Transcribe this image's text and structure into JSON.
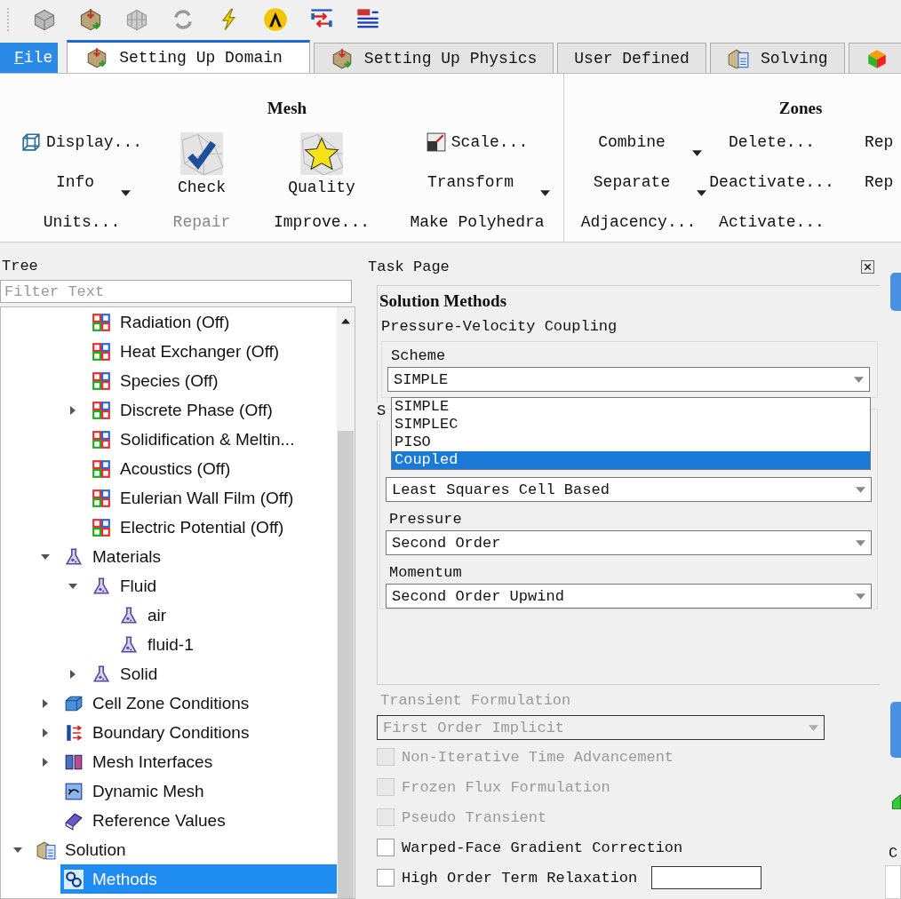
{
  "menu": {
    "label": "File"
  },
  "tabs": [
    {
      "label": "Setting Up Domain",
      "selected": true
    },
    {
      "label": "Setting Up Physics",
      "selected": false
    },
    {
      "label": "User Defined",
      "selected": false
    },
    {
      "label": "Solving",
      "selected": false
    },
    {
      "selected": false
    }
  ],
  "ribbon": {
    "groups": [
      {
        "title": "Mesh",
        "columns": [
          [
            {
              "label": "Display...",
              "kind": "icon",
              "disabled": false
            },
            {
              "label": "Info",
              "kind": "dropdown",
              "disabled": false
            },
            {
              "label": "Units...",
              "kind": "plain",
              "disabled": false
            }
          ],
          [
            {
              "label": "Check",
              "kind": "big",
              "disabled": false
            },
            {
              "label": "Repair",
              "kind": "plain",
              "disabled": true
            }
          ],
          [
            {
              "label": "Quality",
              "kind": "big",
              "disabled": false
            },
            {
              "label": "Improve...",
              "kind": "plain",
              "disabled": false
            }
          ],
          [
            {
              "label": "Scale...",
              "kind": "icon",
              "disabled": false
            },
            {
              "label": "Transform",
              "kind": "dropdown",
              "disabled": false
            },
            {
              "label": "Make Polyhedra",
              "kind": "plain",
              "disabled": false
            }
          ]
        ]
      },
      {
        "title": "Zones",
        "columns": [
          [
            {
              "label": "Combine",
              "kind": "dropdown",
              "disabled": false
            },
            {
              "label": "Separate",
              "kind": "dropdown",
              "disabled": false
            },
            {
              "label": "Adjacency...",
              "kind": "plain",
              "disabled": false
            }
          ],
          [
            {
              "label": "Delete...",
              "kind": "plain",
              "disabled": false
            },
            {
              "label": "Deactivate...",
              "kind": "plain",
              "disabled": false
            },
            {
              "label": "Activate...",
              "kind": "plain",
              "disabled": false
            }
          ],
          [
            {
              "label": "Rep",
              "kind": "plain",
              "disabled": false
            },
            {
              "label": "Rep",
              "kind": "plain",
              "disabled": false
            }
          ]
        ]
      }
    ]
  },
  "tree": {
    "title": "Tree",
    "filter": {
      "placeholder": "Filter Text"
    },
    "items": [
      {
        "children": [
          {
            "children": [
              {
                "label": "Radiation (Off)",
                "kind": "model",
                "selected": false
              },
              {
                "label": "Heat Exchanger (Off)",
                "kind": "model",
                "selected": false
              },
              {
                "label": "Species (Off)",
                "kind": "model",
                "selected": false
              },
              {
                "label": "Discrete Phase (Off)",
                "kind": "model",
                "selected": false,
                "expanded": false
              },
              {
                "label": "Solidification & Meltin...",
                "kind": "model",
                "selected": false
              },
              {
                "label": "Acoustics (Off)",
                "kind": "model",
                "selected": false
              },
              {
                "label": "Eulerian Wall Film (Off)",
                "kind": "model",
                "selected": false
              },
              {
                "label": "Electric Potential (Off)",
                "kind": "model",
                "selected": false
              }
            ]
          },
          {
            "label": "Materials",
            "kind": "material",
            "selected": false,
            "expanded": true,
            "children": [
              {
                "label": "Fluid",
                "kind": "material",
                "selected": false,
                "expanded": true,
                "children": [
                  {
                    "label": "air",
                    "kind": "material",
                    "selected": false
                  },
                  {
                    "label": "fluid-1",
                    "kind": "material",
                    "selected": false
                  }
                ]
              },
              {
                "label": "Solid",
                "kind": "material",
                "selected": false,
                "expanded": false
              }
            ]
          },
          {
            "label": "Cell Zone Conditions",
            "kind": "cell-zone",
            "selected": false,
            "expanded": false
          },
          {
            "label": "Boundary Conditions",
            "kind": "boundary",
            "selected": false,
            "expanded": false
          },
          {
            "label": "Mesh Interfaces",
            "kind": "interface",
            "selected": false,
            "expanded": false
          },
          {
            "label": "Dynamic Mesh",
            "kind": "dynamic",
            "selected": false
          },
          {
            "label": "Reference Values",
            "kind": "reference",
            "selected": false
          }
        ]
      },
      {
        "label": "Solution",
        "kind": "solution",
        "selected": false,
        "expanded": true,
        "children": [
          {
            "label": "Methods",
            "kind": "method",
            "selected": true
          }
        ]
      }
    ]
  },
  "task_page": {
    "title": "Task Page",
    "heading": "Solution Methods",
    "coupling": {
      "title": "Pressure-Velocity Coupling",
      "scheme_label": "Scheme",
      "scheme_value": "SIMPLE",
      "open": true,
      "options": [
        {
          "label": "SIMPLE",
          "selected": false
        },
        {
          "label": "SIMPLEC",
          "selected": false
        },
        {
          "label": "PISO",
          "selected": false
        },
        {
          "label": "Coupled",
          "selected": true
        }
      ]
    },
    "spatial": {
      "title": "S",
      "fields": [
        {
          "value": "Least Squares Cell Based"
        },
        {
          "label": "Pressure",
          "value": "Second Order"
        },
        {
          "label": "Momentum",
          "value": "Second Order Upwind"
        }
      ]
    },
    "transient": {
      "label": "Transient Formulation",
      "value": "First Order Implicit",
      "disabled": true
    },
    "checkboxes": [
      {
        "label": "Non-Iterative Time Advancement",
        "checked": false,
        "disabled": true
      },
      {
        "label": "Frozen Flux Formulation",
        "checked": false,
        "disabled": true
      },
      {
        "label": "Pseudo Transient",
        "checked": false,
        "disabled": true
      },
      {
        "label": "Warped-Face Gradient Correction",
        "checked": false,
        "disabled": false
      },
      {
        "label": "High Order Term Relaxation",
        "checked": false,
        "disabled": false,
        "kind": "with-options"
      }
    ]
  },
  "side_panel": {
    "label": "C"
  }
}
